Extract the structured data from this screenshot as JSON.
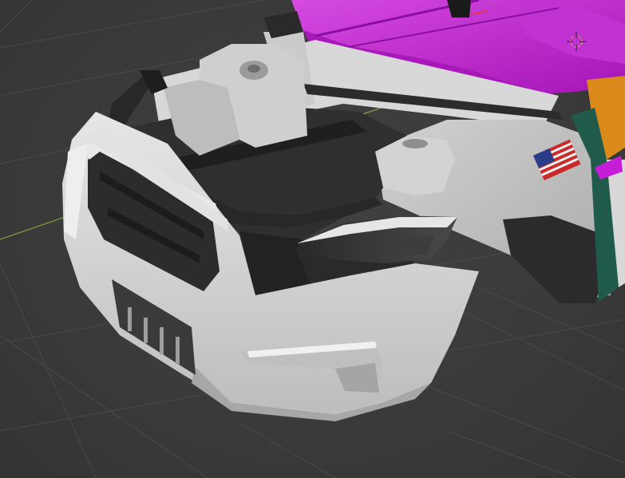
{
  "app": {
    "kind": "3d-viewport",
    "background_color": "#3a3a3a",
    "grid_color": "#4a4a4a",
    "x_axis_color": "#7fa33a"
  },
  "scene": {
    "model": {
      "body_color": "#dcdcdc",
      "frame_color": "#262626",
      "selected_color": "#c61ed8",
      "accent_orange": "#d98a1a",
      "accent_teal": "#1f5a4a"
    },
    "icons": [
      "3d-cursor-icon",
      "us-flag-decal-icon"
    ]
  }
}
